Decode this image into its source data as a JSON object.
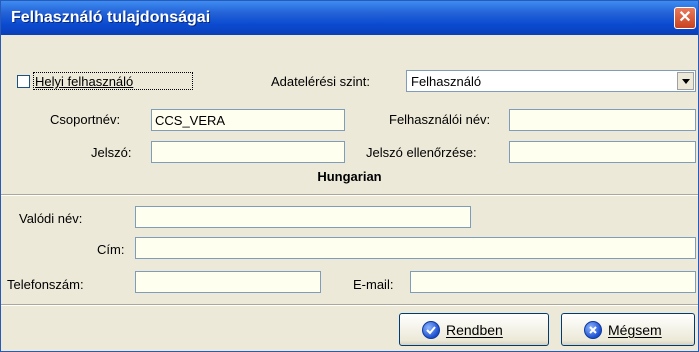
{
  "window": {
    "title": "Felhasználó tulajdonságai",
    "close": "✕"
  },
  "form": {
    "local_user_label": "Helyi felhasználó",
    "local_user_checked": false,
    "access_level_label": "Adatelérési szint:",
    "access_level_value": "Felhasználó",
    "group_name_label": "Csoportnév:",
    "group_name_value": "CCS_VERA",
    "username_label": "Felhasználói név:",
    "username_value": "",
    "password_label": "Jelszó:",
    "password_value": "",
    "password_confirm_label": "Jelszó ellenőrzése:",
    "password_confirm_value": ""
  },
  "section": {
    "title": "Hungarian"
  },
  "details": {
    "real_name_label": "Valódi név:",
    "real_name_value": "",
    "address_label": "Cím:",
    "address_value": "",
    "phone_label": "Telefonszám:",
    "phone_value": "",
    "email_label": "E-mail:",
    "email_value": ""
  },
  "buttons": {
    "ok": "Rendben",
    "cancel": "Mégsem"
  }
}
